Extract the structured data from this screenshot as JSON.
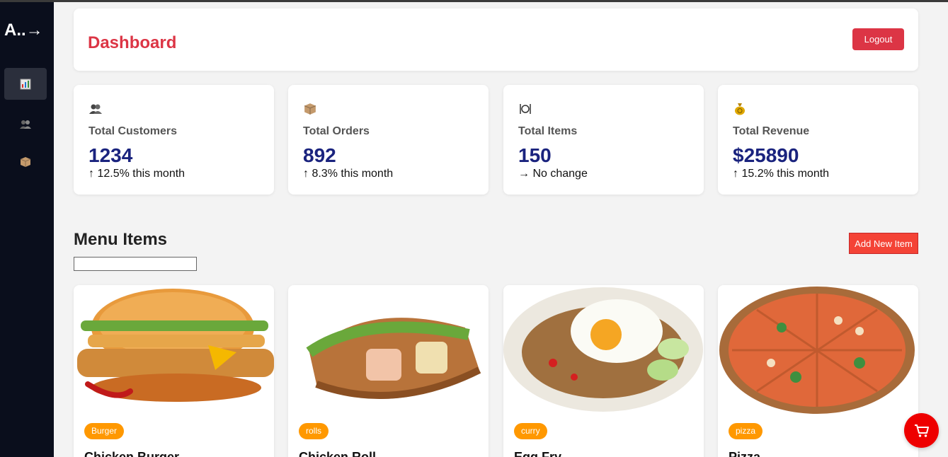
{
  "sidebar": {
    "brand": "A..→",
    "items": [
      {
        "icon": "chart-icon"
      },
      {
        "icon": "users-icon"
      },
      {
        "icon": "box-icon"
      }
    ]
  },
  "header": {
    "title": "Dashboard",
    "logout_label": "Logout"
  },
  "stats": [
    {
      "label": "Total Customers",
      "value": "1234",
      "change": "↑ 12.5% this month",
      "icon": "users-icon"
    },
    {
      "label": "Total Orders",
      "value": "892",
      "change": "↑ 8.3% this month",
      "icon": "box-icon"
    },
    {
      "label": "Total Items",
      "value": "150",
      "change": "→ No change",
      "icon": "utensils-icon"
    },
    {
      "label": "Total Revenue",
      "value": "$25890",
      "change": "↑ 15.2% this month",
      "icon": "money-bag-icon"
    }
  ],
  "menu": {
    "title": "Menu Items",
    "add_label": "Add New Item",
    "search_placeholder": "",
    "items": [
      {
        "category": "Burger",
        "name": "Chicken Burger"
      },
      {
        "category": "rolls",
        "name": "Chicken Roll"
      },
      {
        "category": "curry",
        "name": "Egg Fry"
      },
      {
        "category": "pizza",
        "name": "Pizza"
      }
    ]
  },
  "colors": {
    "accent": "#dc3545",
    "value": "#1a237e",
    "badge": "#ff9800",
    "cart": "#ee0000",
    "sidebar": "#0a0e1c"
  }
}
